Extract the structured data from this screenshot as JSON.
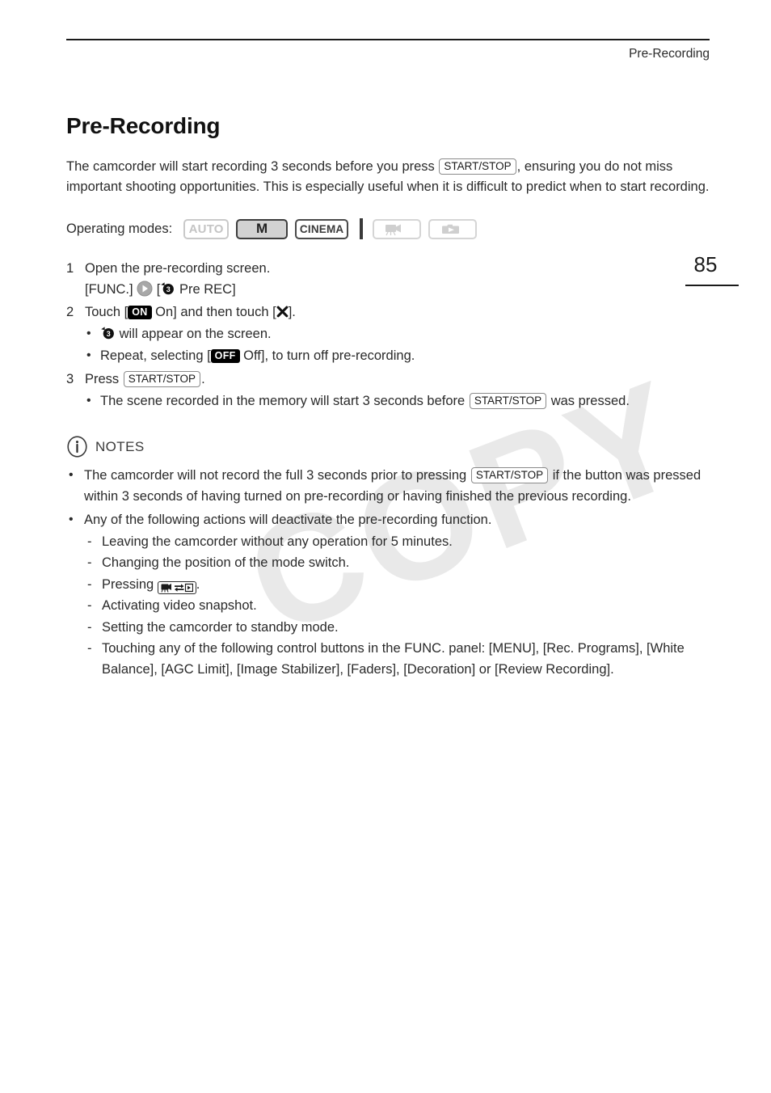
{
  "header": {
    "running_title": "Pre-Recording"
  },
  "page_number": "85",
  "watermark": "COPY",
  "main": {
    "title": "Pre-Recording",
    "intro_part1": "The camcorder will start recording 3 seconds before you press",
    "intro_key": "START/STOP",
    "intro_part2": ", ensuring you do not miss important shooting opportunities. This is especially useful when it is difficult to predict when to start recording."
  },
  "operating_modes": {
    "label": "Operating modes:",
    "badges": [
      {
        "label": "AUTO",
        "state": "inactive",
        "icon": "auto-mode-badge"
      },
      {
        "label": "M",
        "state": "active",
        "icon": "manual-mode-badge"
      },
      {
        "label": "CINEMA",
        "state": "outlined",
        "icon": "cinema-mode-badge"
      },
      {
        "label": "",
        "state": "inactive-icon",
        "icon": "movie-playback-icon"
      },
      {
        "label": "",
        "state": "inactive-icon",
        "icon": "photo-playback-icon"
      }
    ]
  },
  "steps": [
    {
      "number": "1",
      "text": "Open the pre-recording screen.",
      "sub_prefix": "[FUNC.]",
      "sub_bracket_open": "[",
      "sub_label": "Pre REC]"
    },
    {
      "number": "2",
      "text_part1": "Touch [",
      "badge_on": "ON",
      "text_part2": "On] and then touch [",
      "text_part3": "].",
      "bullets": [
        {
          "text_after_icon": "will appear on the screen."
        },
        {
          "text_part1": "Repeat, selecting [",
          "badge_off": "OFF",
          "text_part2": "Off], to turn off pre-recording."
        }
      ]
    },
    {
      "number": "3",
      "text_part1": "Press",
      "key": "START/STOP",
      "text_part2": ".",
      "bullets": [
        {
          "text_part1": "The scene recorded in the memory will start 3 seconds before",
          "key": "START/STOP",
          "text_part2": "was pressed."
        }
      ]
    }
  ],
  "notes": {
    "title": "NOTES",
    "items": [
      {
        "text_part1": "The camcorder will not record the full 3 seconds prior to pressing",
        "key": "START/STOP",
        "text_part2": "if the button was pressed within 3 seconds of having turned on pre-recording or having finished the previous recording."
      },
      {
        "text_part1": "Any of the following actions will deactivate the pre-recording function.",
        "sub_items": [
          {
            "text": "Leaving the camcorder without any operation for 5 minutes."
          },
          {
            "text": "Changing the position of the mode switch."
          },
          {
            "text_part1": "Pressing",
            "icon": "camera-playback-toggle-icon",
            "text_part2": "."
          },
          {
            "text": "Activating video snapshot."
          },
          {
            "text": "Setting the camcorder to standby mode."
          },
          {
            "text": "Touching any of the following control buttons in the FUNC. panel: [MENU], [Rec. Programs], [White Balance], [AGC Limit], [Image Stabilizer], [Faders], [Decoration] or [Review Recording]."
          }
        ]
      }
    ]
  }
}
